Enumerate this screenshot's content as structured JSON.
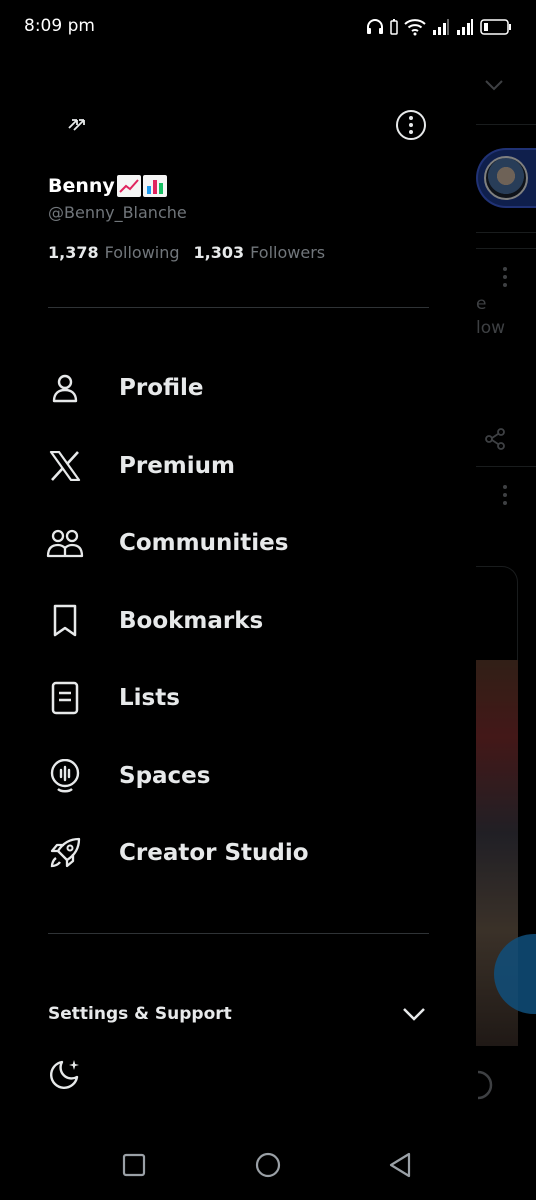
{
  "status_bar": {
    "time": "8:09 pm"
  },
  "drawer": {
    "display_name": "Benny",
    "handle": "@Benny_Blanche",
    "following_count": "1,378",
    "following_label": "Following",
    "followers_count": "1,303",
    "followers_label": "Followers"
  },
  "menu": {
    "items": [
      {
        "label": "Profile",
        "icon": "person-icon"
      },
      {
        "label": "Premium",
        "icon": "x-logo-icon"
      },
      {
        "label": "Communities",
        "icon": "communities-icon"
      },
      {
        "label": "Bookmarks",
        "icon": "bookmark-icon"
      },
      {
        "label": "Lists",
        "icon": "list-icon"
      },
      {
        "label": "Spaces",
        "icon": "spaces-icon"
      },
      {
        "label": "Creator Studio",
        "icon": "rocket-icon"
      }
    ]
  },
  "settings": {
    "label": "Settings & Support"
  },
  "background_feed": {
    "text_1": "e",
    "text_2": "low"
  },
  "colors": {
    "background": "#000000",
    "text": "#e7e9ea",
    "muted": "#71767b",
    "divider": "#2f3336"
  }
}
